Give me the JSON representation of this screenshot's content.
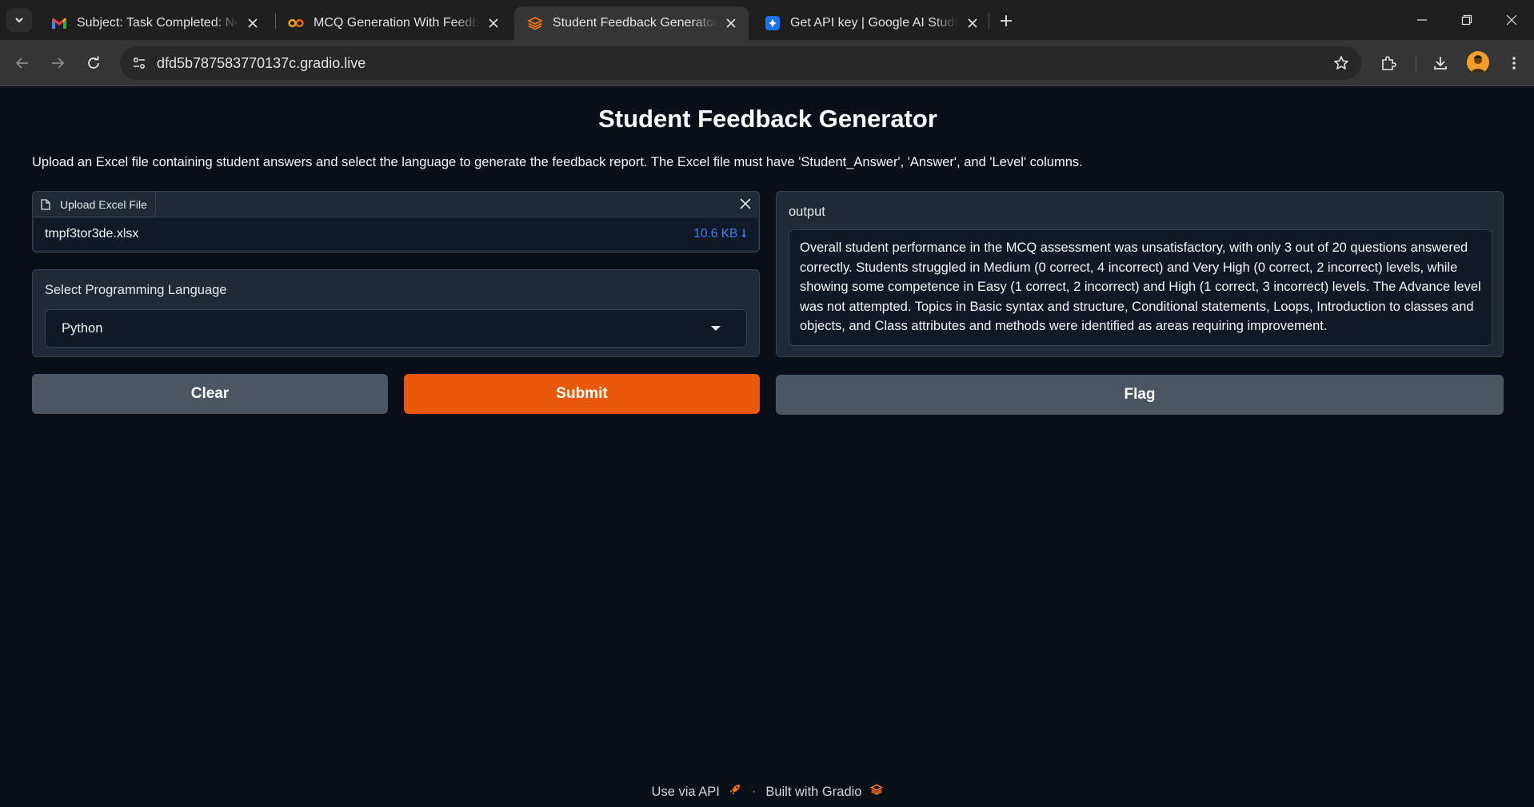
{
  "browser": {
    "tabs": [
      {
        "title": "Subject: Task Completed: New L",
        "icon": "gmail-icon",
        "active": false
      },
      {
        "title": "MCQ Generation With Feedback",
        "icon": "colab-icon",
        "active": false
      },
      {
        "title": "Student Feedback Generator",
        "icon": "gradio-icon",
        "active": true
      },
      {
        "title": "Get API key | Google AI Studio",
        "icon": "ai-studio-icon",
        "active": false
      }
    ],
    "url": "dfd5b787583770137c.gradio.live"
  },
  "app": {
    "title": "Student Feedback Generator",
    "description": "Upload an Excel file containing student answers and select the language to generate the feedback report. The Excel file must have 'Student_Answer', 'Answer', and 'Level' columns.",
    "file_upload": {
      "label": "Upload Excel File",
      "file_name": "tmpf3tor3de.xlsx",
      "file_size": "10.6 KB"
    },
    "language": {
      "label": "Select Programming Language",
      "selected": "Python"
    },
    "output": {
      "label": "output",
      "text": "Overall student performance in the MCQ assessment was unsatisfactory, with only 3 out of 20 questions answered correctly. Students struggled in Medium (0 correct, 4 incorrect) and Very High (0 correct, 2 incorrect) levels, while showing some competence in Easy (1 correct, 2 incorrect) and High (1 correct, 3 incorrect) levels. The Advance level was not attempted. Topics in Basic syntax and structure, Conditional statements, Loops, Introduction to classes and objects, and Class attributes and methods were identified as areas requiring improvement."
    },
    "buttons": {
      "clear": "Clear",
      "submit": "Submit",
      "flag": "Flag"
    },
    "footer": {
      "api": "Use via API",
      "separator": "·",
      "built": "Built with Gradio"
    }
  },
  "colors": {
    "accent": "#ea580c",
    "background": "#0b0f19",
    "panel": "#1f2937",
    "file_size": "#3b82f6"
  }
}
